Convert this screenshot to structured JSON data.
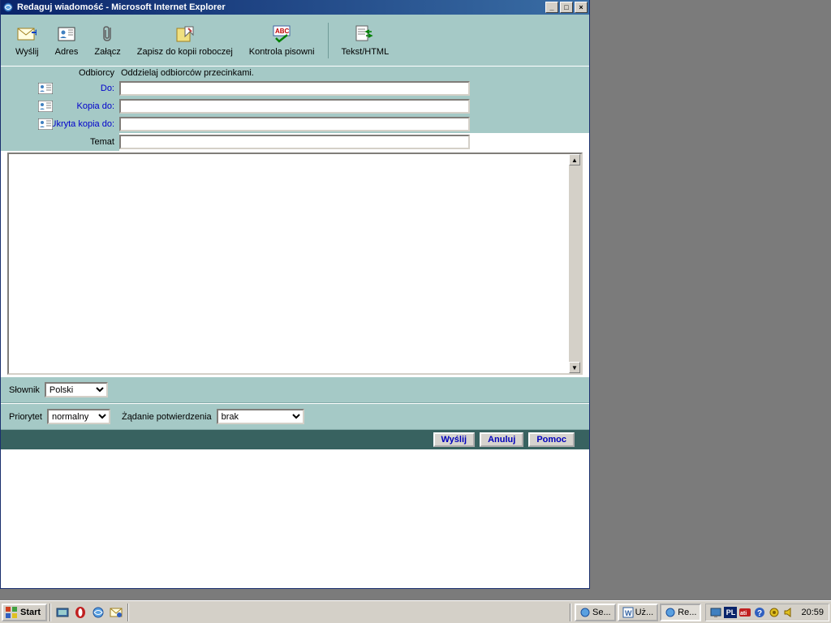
{
  "window": {
    "title": "Redaguj wiadomość - Microsoft Internet Explorer"
  },
  "toolbar": {
    "send": "Wyślij",
    "address": "Adres",
    "attach": "Załącz",
    "saveDraft": "Zapisz do kopii roboczej",
    "spellcheck": "Kontrola pisowni",
    "textHtml": "Tekst/HTML"
  },
  "headers": {
    "recipientsLabel": "Odbiorcy",
    "recipientsHint": "Oddzielaj odbiorców przecinkami.",
    "toLabel": "Do:",
    "toValue": "",
    "ccLabel": "Kopia do:",
    "ccValue": "",
    "bccLabel": "Ukryta kopia do:",
    "bccValue": "",
    "subjectLabel": "Temat",
    "subjectValue": ""
  },
  "body": {
    "value": ""
  },
  "options": {
    "dictLabel": "Słownik",
    "dictValue": "Polski",
    "priorityLabel": "Priorytet",
    "priorityValue": "normalny",
    "confirmLabel": "Żądanie potwierdzenia",
    "confirmValue": "brak"
  },
  "actions": {
    "send": "Wyślij",
    "cancel": "Anuluj",
    "help": "Pomoc"
  },
  "taskbar": {
    "start": "Start",
    "items": [
      {
        "label": "Se...",
        "active": false
      },
      {
        "label": "Uż...",
        "active": false
      },
      {
        "label": "Re...",
        "active": true
      }
    ],
    "lang": "PL",
    "clock": "20:59"
  }
}
